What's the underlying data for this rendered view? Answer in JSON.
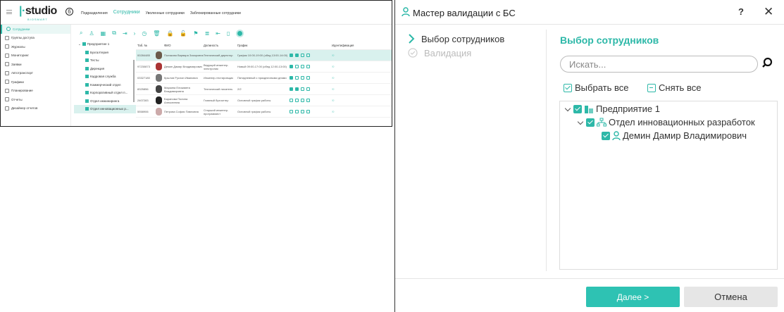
{
  "app": {
    "logo": "studio",
    "logo_num": "6",
    "logo_sub": "BIOSMART",
    "top_tabs": [
      "Подразделения",
      "Сотрудники",
      "Уволенные сотрудники",
      "Заблокированные сотрудники"
    ],
    "sidebar": [
      "Сотрудники",
      "Группы доступа",
      "Журналы",
      "Мониторинг",
      "Заявки",
      "Автотранспорт",
      "Графики",
      "Планирование",
      "Отчеты",
      "Дизайнер отчетов"
    ],
    "tree": [
      "Предприятие 1",
      "Бухгалтерия",
      "Тесты",
      "Дирекция",
      "Кадровая служба",
      "Коммерческий отдел",
      "Корпоративный отдел п...",
      "Отдел инжиниринга",
      "Отдел инновационных р..."
    ],
    "table_headers": [
      "Таб. №",
      "ФИО",
      "Должность",
      "График",
      "Идентификация"
    ],
    "rows": [
      {
        "tab": "00284485",
        "name": "Полякова Варвара Захаровна",
        "pos": "Технический директор",
        "sched": "График 10:00-19:00 (обед 13:00-14:00)"
      },
      {
        "tab": "97230873",
        "name": "Демин Дамир Владимирович",
        "pos": "Ведущий инженер-электроник",
        "sched": "Новый 09:00-17:00 (обед 12:00-13:00)"
      },
      {
        "tab": "03327180",
        "name": "Крылов Руслан Иванович",
        "pos": "Инженер-тестировщик",
        "sched": "Пятидневный с праздничными днями"
      },
      {
        "tab": "8325856",
        "name": "Маркина Елизавета Владимировна",
        "pos": "Технический писатель",
        "sched": "2/2"
      },
      {
        "tab": "2407283",
        "name": "Баранова Полина Алексеевна",
        "pos": "Главный бухгалтер",
        "sched": "Основной график работы"
      },
      {
        "tab": "5558906",
        "name": "Петрова София Павловна",
        "pos": "Старший инженер-программист",
        "sched": "Основной график работы"
      }
    ]
  },
  "dialog": {
    "title": "Мастер валидации с БС",
    "help": "?",
    "close": "✕",
    "steps": [
      "Выбор сотрудников",
      "Валидация"
    ],
    "panel_title": "Выбор сотрудников",
    "search_placeholder": "Искать...",
    "select_all": "Выбрать все",
    "unselect_all": "Снять все",
    "tree": {
      "root": "Предприятие 1",
      "dept": "Отдел инновационных разработок",
      "employee": "Демин  Дамир  Владимирович"
    },
    "next": "Далее >",
    "cancel": "Отмена"
  },
  "colors": {
    "accent": "#2db8a8"
  }
}
